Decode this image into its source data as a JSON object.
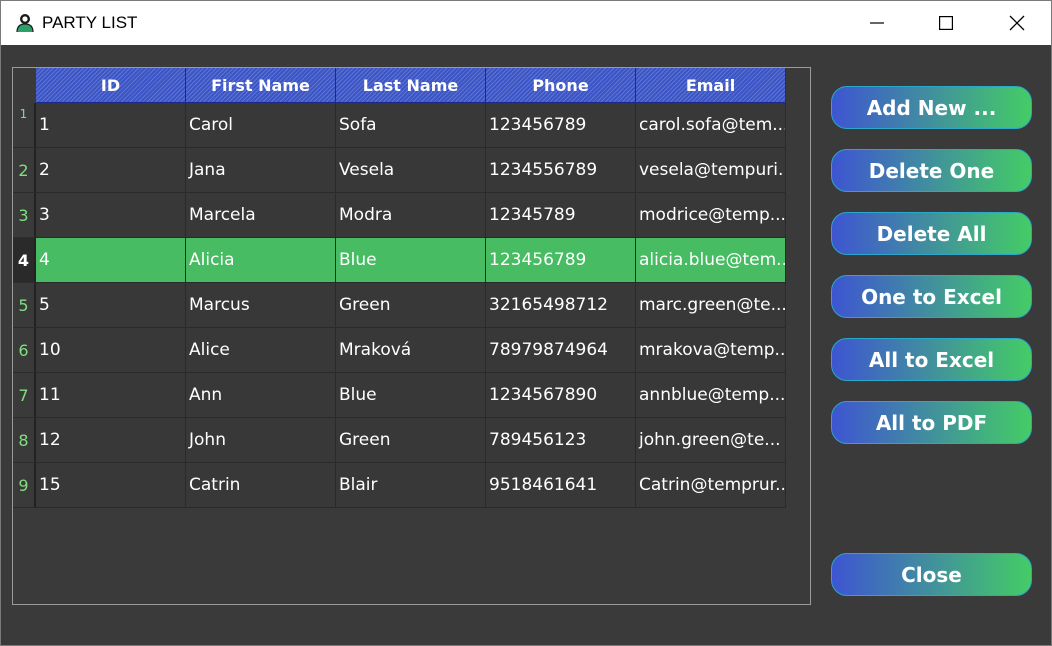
{
  "window": {
    "title": "PARTY LIST"
  },
  "grid": {
    "columns": [
      "ID",
      "First Name",
      "Last Name",
      "Phone",
      "Email"
    ],
    "rows": [
      {
        "num": "1",
        "id": "1",
        "first": "Carol",
        "last": "Sofa",
        "phone": "123456789",
        "email": "carol.sofa@tem..."
      },
      {
        "num": "2",
        "id": "2",
        "first": "Jana",
        "last": "Vesela",
        "phone": "1234556789",
        "email": "vesela@tempuri..."
      },
      {
        "num": "3",
        "id": "3",
        "first": "Marcela",
        "last": "Modra",
        "phone": "12345789",
        "email": "modrice@temp..."
      },
      {
        "num": "4",
        "id": "4",
        "first": "Alicia",
        "last": "Blue",
        "phone": "123456789",
        "email": "alicia.blue@tem..."
      },
      {
        "num": "5",
        "id": "5",
        "first": "Marcus",
        "last": "Green",
        "phone": "32165498712",
        "email": "marc.green@te..."
      },
      {
        "num": "6",
        "id": "10",
        "first": "Alice",
        "last": "Mraková",
        "phone": "78979874964",
        "email": "mrakova@temp..."
      },
      {
        "num": "7",
        "id": "11",
        "first": "Ann",
        "last": "Blue",
        "phone": "1234567890",
        "email": "annblue@temp..."
      },
      {
        "num": "8",
        "id": "12",
        "first": "John",
        "last": "Green",
        "phone": "789456123",
        "email": "john.green@te..."
      },
      {
        "num": "9",
        "id": "15",
        "first": "Catrin",
        "last": "Blair",
        "phone": "9518461641",
        "email": "Catrin@temprur..."
      }
    ]
  },
  "buttons": {
    "add_new": "Add New ...",
    "delete_one": "Delete One",
    "delete_all": "Delete All",
    "one_to_excel": "One to Excel",
    "all_to_excel": "All to Excel",
    "all_to_pdf": "All to PDF",
    "close": "Close"
  },
  "colors": {
    "header": "#3b55c6",
    "selected_row": "#47bc62",
    "row_number": "#7fe07f",
    "background": "#3a3a3a"
  },
  "icons": {
    "app": "person-icon",
    "minimize": "minimize-icon",
    "maximize": "maximize-icon",
    "close": "close-icon"
  }
}
